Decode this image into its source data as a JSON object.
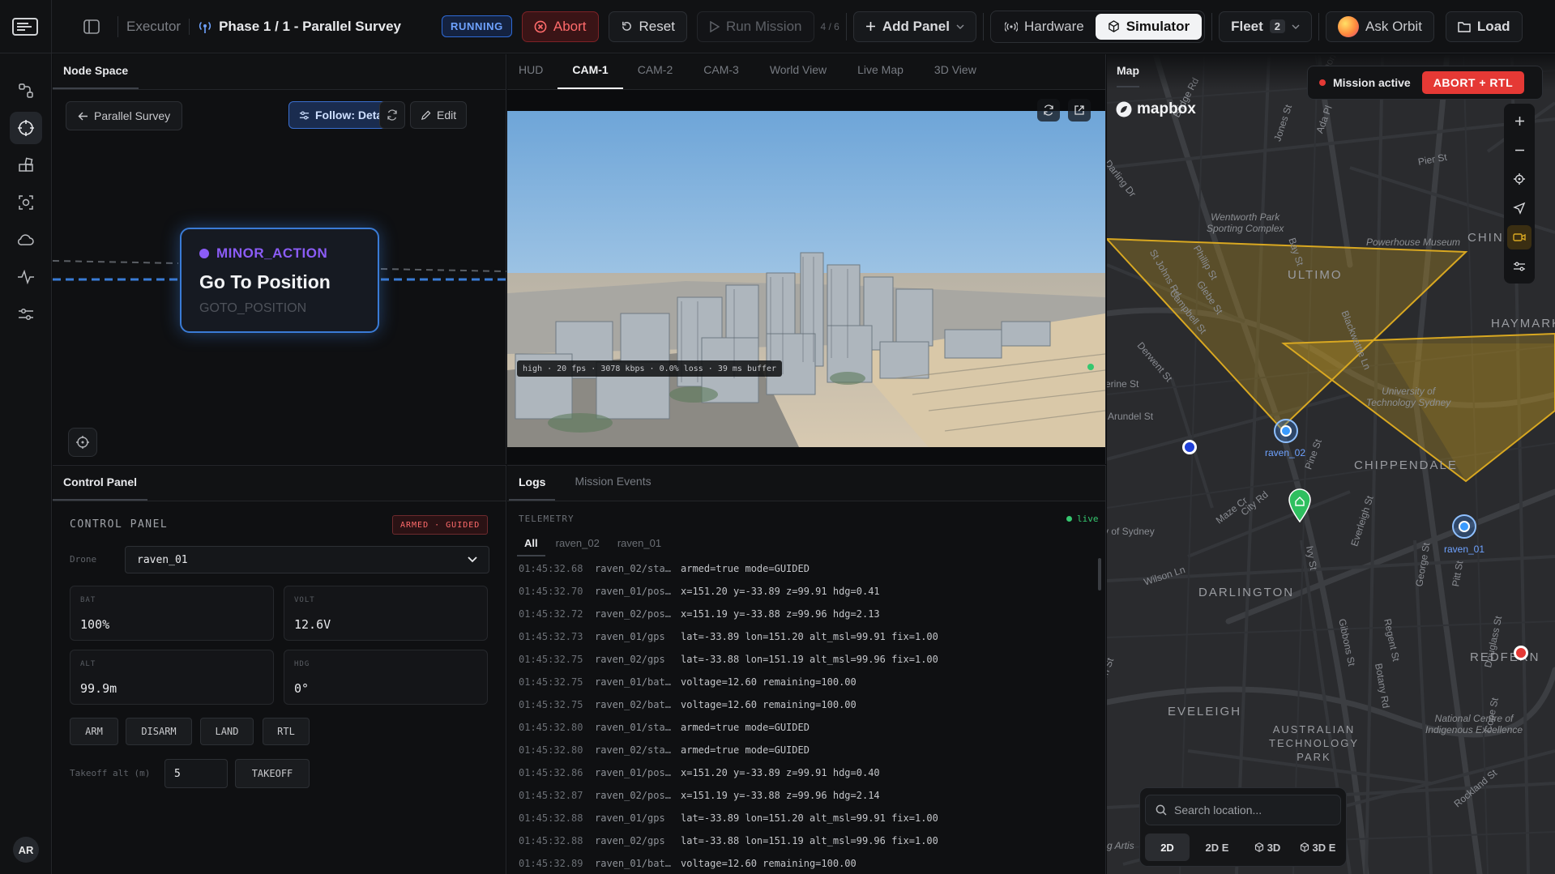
{
  "topbar": {
    "app_section": "Executor",
    "mission": "Phase 1 / 1 - Parallel Survey",
    "status": "RUNNING",
    "abort": "Abort",
    "reset": "Reset",
    "run_mission": "Run Mission",
    "run_count": "4 / 6",
    "add_panel": "Add Panel",
    "hardware": "Hardware",
    "simulator": "Simulator",
    "fleet": "Fleet",
    "fleet_count": "2",
    "ask_orbit": "Ask Orbit",
    "load": "Load"
  },
  "rail": {
    "avatar": "AR"
  },
  "node_space": {
    "tab": "Node Space",
    "back_label": "Parallel Survey",
    "follow_label": "Follow: Detail",
    "edit_label": "Edit",
    "node": {
      "category": "MINOR_ACTION",
      "title": "Go To Position",
      "type": "GOTO_POSITION"
    }
  },
  "control_panel": {
    "tab": "Control Panel",
    "title": "CONTROL PANEL",
    "state_badge": "ARMED · GUIDED",
    "drone_label": "Drone",
    "drone_value": "raven_01",
    "stats": [
      {
        "key": "BAT",
        "value": "100%"
      },
      {
        "key": "VOLT",
        "value": "12.6V"
      },
      {
        "key": "ALT",
        "value": "99.9m"
      },
      {
        "key": "HDG",
        "value": "0°"
      }
    ],
    "buttons": [
      "ARM",
      "DISARM",
      "LAND",
      "RTL"
    ],
    "takeoff_label": "Takeoff alt (m)",
    "takeoff_value": "5",
    "takeoff_button": "TAKEOFF"
  },
  "video": {
    "tabs": [
      "HUD",
      "CAM-1",
      "CAM-2",
      "CAM-3",
      "World View",
      "Live Map",
      "3D View"
    ],
    "active_tab": "CAM-1",
    "stream_info": "high · 20 fps · 3078 kbps · 0.0% loss · 39 ms buffer"
  },
  "logs": {
    "tabs": [
      "Logs",
      "Mission Events"
    ],
    "section": "TELEMETRY",
    "live": "live",
    "filters": [
      "All",
      "raven_02",
      "raven_01"
    ],
    "rows": [
      {
        "time": "01:45:32.68",
        "src": "raven_02/sta…",
        "msg": "armed=true mode=GUIDED"
      },
      {
        "time": "01:45:32.70",
        "src": "raven_01/pos…",
        "msg": "x=151.20 y=-33.89 z=99.91 hdg=0.41"
      },
      {
        "time": "01:45:32.72",
        "src": "raven_02/pos…",
        "msg": "x=151.19 y=-33.88 z=99.96 hdg=2.13"
      },
      {
        "time": "01:45:32.73",
        "src": "raven_01/gps",
        "msg": "lat=-33.89 lon=151.20 alt_msl=99.91 fix=1.00"
      },
      {
        "time": "01:45:32.75",
        "src": "raven_02/gps",
        "msg": "lat=-33.88 lon=151.19 alt_msl=99.96 fix=1.00"
      },
      {
        "time": "01:45:32.75",
        "src": "raven_01/bat…",
        "msg": "voltage=12.60 remaining=100.00"
      },
      {
        "time": "01:45:32.75",
        "src": "raven_02/bat…",
        "msg": "voltage=12.60 remaining=100.00"
      },
      {
        "time": "01:45:32.80",
        "src": "raven_01/sta…",
        "msg": "armed=true mode=GUIDED"
      },
      {
        "time": "01:45:32.80",
        "src": "raven_02/sta…",
        "msg": "armed=true mode=GUIDED"
      },
      {
        "time": "01:45:32.86",
        "src": "raven_01/pos…",
        "msg": "x=151.20 y=-33.89 z=99.91 hdg=0.40"
      },
      {
        "time": "01:45:32.87",
        "src": "raven_02/pos…",
        "msg": "x=151.19 y=-33.88 z=99.96 hdg=2.14"
      },
      {
        "time": "01:45:32.88",
        "src": "raven_01/gps",
        "msg": "lat=-33.89 lon=151.20 alt_msl=99.91 fix=1.00"
      },
      {
        "time": "01:45:32.88",
        "src": "raven_02/gps",
        "msg": "lat=-33.88 lon=151.19 alt_msl=99.96 fix=1.00"
      },
      {
        "time": "01:45:32.89",
        "src": "raven_01/bat…",
        "msg": "voltage=12.60 remaining=100.00"
      }
    ]
  },
  "map": {
    "tab": "Map",
    "mission_active": "Mission active",
    "abort_rtl": "ABORT + RTL",
    "brand": "mapbox",
    "search_placeholder": "Search location...",
    "modes": [
      "2D",
      "2D E",
      "3D",
      "3D E"
    ],
    "active_mode": "2D",
    "drones": [
      "raven_02",
      "raven_01"
    ],
    "districts": [
      "ULTIMO",
      "HAYMARKET",
      "CHIPPENDALE",
      "DARLINGTON",
      "EVELEIGH",
      "REDFERN",
      "CHINA"
    ],
    "district_multi": [
      "AUSTRALIAN",
      "TECHNOLOGY",
      "PARK"
    ],
    "streets": [
      "Bridge Rd",
      "Jones St",
      "Ada Pl",
      "Pyrmont St",
      "Darling Dr",
      "Pier St",
      "St Johns Rd",
      "Phillip St",
      "Bay St",
      "Glebe St",
      "Campbell St",
      "Derwent St",
      "Blackwattle Ln",
      "Arundel St",
      "City Rd",
      "Maze Cr",
      "Ivy St",
      "Pine St",
      "Everleigh St",
      "Wilson Ln",
      "Gibbons St",
      "Regent St",
      "Botany Rd",
      "George St",
      "Pitt St",
      "Douglass St",
      "Cope St",
      "Rockland St",
      "erine St",
      "on St",
      "ity of Sydney"
    ],
    "pois": [
      {
        "l1": "Wentworth Park",
        "l2": "Sporting Complex"
      },
      {
        "l1": "Powerhouse Museum",
        "l2": ""
      },
      {
        "l1": "University of",
        "l2": "Technology Sydney"
      },
      {
        "l1": "National Centre of",
        "l2": "Indigenous Excellence"
      },
      {
        "l1": "g Artis",
        "l2": ""
      }
    ]
  },
  "colors": {
    "accent": "#3a7bd5",
    "danger": "#e53935",
    "survey": "#d9a821",
    "node": "#8b5cf6"
  }
}
